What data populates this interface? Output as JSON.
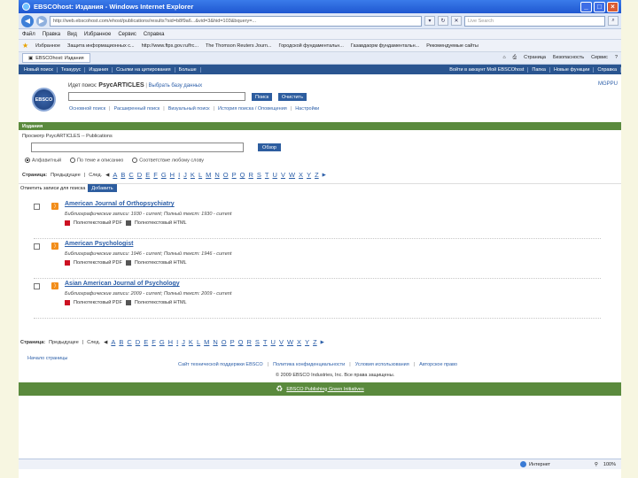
{
  "window": {
    "title": "EBSCOhost: Издания - Windows Internet Explorer"
  },
  "addressbar": {
    "url": "http://web.ebscohost.com/ehost/publications/results?sid=b8f9a6...&vid=3&hid=103&bquery=...",
    "search_placeholder": "Live Search"
  },
  "menubar": [
    "Файл",
    "Правка",
    "Вид",
    "Избранное",
    "Сервис",
    "Справка"
  ],
  "favorites": {
    "label": "Избранное",
    "items": [
      "Защита информационных с...",
      "http://www.ftps.gov.ru/frc...",
      "The Thomson Reuters Journ...",
      "Городской фундаментальн...",
      "Газавдаорм фундаментальн...",
      "Рекомендуемые сайты"
    ]
  },
  "tab": {
    "label": "EBSCOhost: Издания"
  },
  "tabtools": [
    "Страница",
    "Безопасность",
    "Сервис"
  ],
  "ebsco_toolbar": {
    "items": [
      "Новый поиск",
      "Тезаурус",
      "Издания",
      "Ссылки на цитирования",
      "Больше"
    ],
    "right": [
      "Войти в аккаунт Мой EBSCOhost",
      "Папка",
      "Новые функции",
      "Справка"
    ]
  },
  "header": {
    "searching_label": "Идет поиск:",
    "database": "PsycARTICLES",
    "choose_db": "Выбрать базу данных",
    "search_btn": "Поиск",
    "clear_btn": "Очистить",
    "links": [
      "Основной поиск",
      "Расширенный поиск",
      "Визуальный поиск",
      "История поиска / Оповещения",
      "Настройки"
    ],
    "mgpp": "MGPPU",
    "logo": "EBSCO"
  },
  "publications": {
    "bar": "Издания",
    "title": "Просмотр PsycARTICLES -- Publications",
    "browse_btn": "Обзор",
    "radios": [
      "Алфавитный",
      "По теме и описанию",
      "Соответствие любому слову"
    ],
    "pages_label": "Страница:",
    "prev": "Предыдущее",
    "next": "След.",
    "letters": [
      "A",
      "B",
      "C",
      "D",
      "E",
      "F",
      "G",
      "H",
      "I",
      "J",
      "K",
      "L",
      "M",
      "N",
      "O",
      "P",
      "Q",
      "R",
      "S",
      "T",
      "U",
      "V",
      "W",
      "X",
      "Y",
      "Z"
    ],
    "mark_label": "Отметить записи для поиска",
    "add_btn": "Добавить"
  },
  "results": [
    {
      "title": "American Journal of Orthopsychiatry",
      "biblio": "Библиографические записи: 1930 - current; Полный текст: 1930 - current",
      "pdf": "Полнотекстовый PDF",
      "html": "Полнотекстовый HTML"
    },
    {
      "title": "American Psychologist",
      "biblio": "Библиографические записи: 1946 - current; Полный текст: 1946 - current",
      "pdf": "Полнотекстовый PDF",
      "html": "Полнотекстовый HTML"
    },
    {
      "title": "Asian American Journal of Psychology",
      "biblio": "Библиографические записи: 2009 - current; Полный текст: 2009 - current",
      "pdf": "Полнотекстовый PDF",
      "html": "Полнотекстовый HTML"
    }
  ],
  "footer": {
    "top_link": "Начало страницы",
    "links": [
      "Сайт технической поддержки EBSCO",
      "Политика конфиденциальности",
      "Условия использования",
      "Авторское право"
    ],
    "copyright": "© 2009 EBSCO Industries, Inc. Все права защищены.",
    "publishing": "EBSCO Publishing Green Initiatives"
  },
  "statusbar": {
    "zone": "Интернет",
    "zoom": "100%"
  }
}
